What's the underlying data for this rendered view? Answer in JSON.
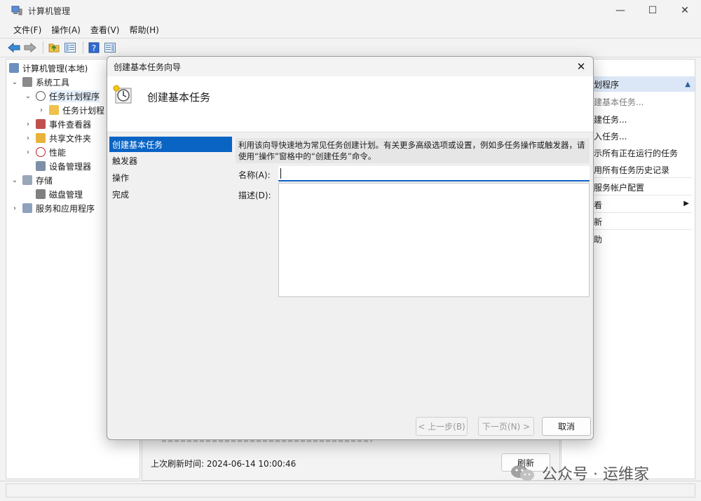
{
  "window": {
    "title": "计算机管理",
    "minimize_glyph": "—",
    "maximize_glyph": "☐",
    "close_glyph": "✕"
  },
  "menubar": {
    "items": [
      {
        "label": "文件(F)"
      },
      {
        "label": "操作(A)"
      },
      {
        "label": "查看(V)"
      },
      {
        "label": "帮助(H)"
      }
    ]
  },
  "toolbar": {
    "buttons": [
      "back-icon",
      "forward-icon",
      "up-folder-icon",
      "show-hide-tree-icon",
      "help-icon",
      "show-hide-action-pane-icon"
    ]
  },
  "tree": {
    "items": [
      {
        "label": "计算机管理(本地)",
        "icon": "computer-icon"
      },
      {
        "label": "系统工具",
        "icon": "tools-icon",
        "chevron": "⌄"
      },
      {
        "label": "任务计划程序",
        "icon": "clock-icon",
        "chevron": "⌄"
      },
      {
        "label": "任务计划程",
        "icon": "folder-icon",
        "chevron": "›"
      },
      {
        "label": "事件查看器",
        "icon": "event-viewer-icon",
        "chevron": "›"
      },
      {
        "label": "共享文件夹",
        "icon": "shared-folder-icon",
        "chevron": "›"
      },
      {
        "label": "性能",
        "icon": "performance-icon",
        "chevron": "›"
      },
      {
        "label": "设备管理器",
        "icon": "device-manager-icon"
      },
      {
        "label": "存储",
        "icon": "storage-icon",
        "chevron": "⌄"
      },
      {
        "label": "磁盘管理",
        "icon": "disk-icon"
      },
      {
        "label": "服务和应用程序",
        "icon": "services-icon",
        "chevron": "›"
      }
    ]
  },
  "middle": {
    "last_refresh": "上次刷新时间: 2024-06-14 10:00:46",
    "refresh_label": "刷新"
  },
  "actions": {
    "header": "划程序",
    "items": [
      {
        "label": "建基本任务..."
      },
      {
        "label": "建任务..."
      },
      {
        "label": "入任务..."
      },
      {
        "label": "示所有正在运行的任务"
      },
      {
        "label": "用所有任务历史记录"
      },
      {
        "label": "服务帐户配置"
      },
      {
        "label": "看"
      },
      {
        "label": "新"
      },
      {
        "label": "助"
      }
    ]
  },
  "dialog": {
    "title": "创建基本任务向导",
    "close_glyph": "✕",
    "heading": "创建基本任务",
    "steps": [
      {
        "label": "创建基本任务"
      },
      {
        "label": "触发器"
      },
      {
        "label": "操作"
      },
      {
        "label": "完成"
      }
    ],
    "description": "利用该向导快速地为常见任务创建计划。有关更多高级选项或设置，例如多任务操作或触发器，请使用“操作”窗格中的“创建任务”命令。",
    "name_label": "名称(A):",
    "name_value": "",
    "desc_label": "描述(D):",
    "desc_value": "",
    "back_label": "< 上一步(B)",
    "next_label": "下一页(N) >",
    "cancel_label": "取消"
  },
  "watermark": {
    "text": "公众号 · 运维家"
  },
  "colors": {
    "accent": "#0a64c4",
    "action_header": "#dbe7f6"
  }
}
